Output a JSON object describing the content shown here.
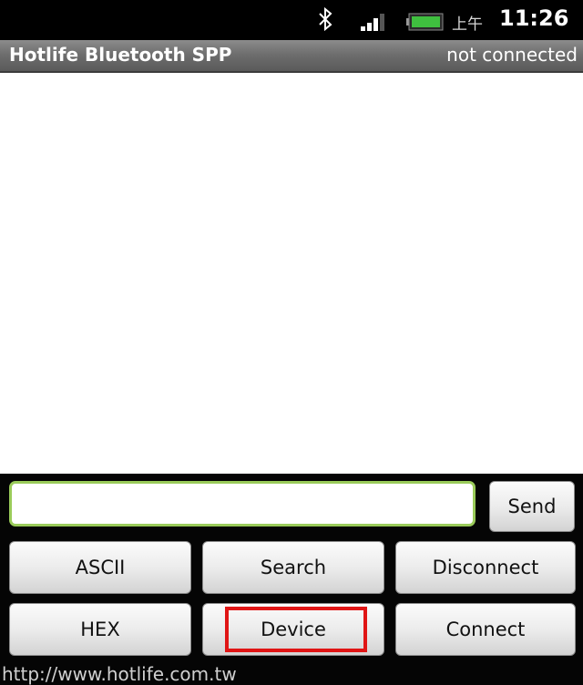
{
  "status_bar": {
    "bluetooth_icon": "bluetooth-icon",
    "signal_icon": "signal-strength-icon",
    "battery_icon": "battery-icon",
    "ampm": "上午",
    "time": "11:26"
  },
  "title_bar": {
    "app_title": "Hotlife Bluetooth SPP",
    "connection_status": "not connected"
  },
  "input": {
    "value": "",
    "placeholder": ""
  },
  "buttons": {
    "send": "Send",
    "ascii": "ASCII",
    "search": "Search",
    "disconnect": "Disconnect",
    "hex": "HEX",
    "device": "Device",
    "connect": "Connect"
  },
  "footer": {
    "link": "http://www.hotlife.com.tw"
  },
  "colors": {
    "highlight": "#e01515",
    "input_border": "#9acb5a",
    "battery": "#3fbf3f"
  }
}
